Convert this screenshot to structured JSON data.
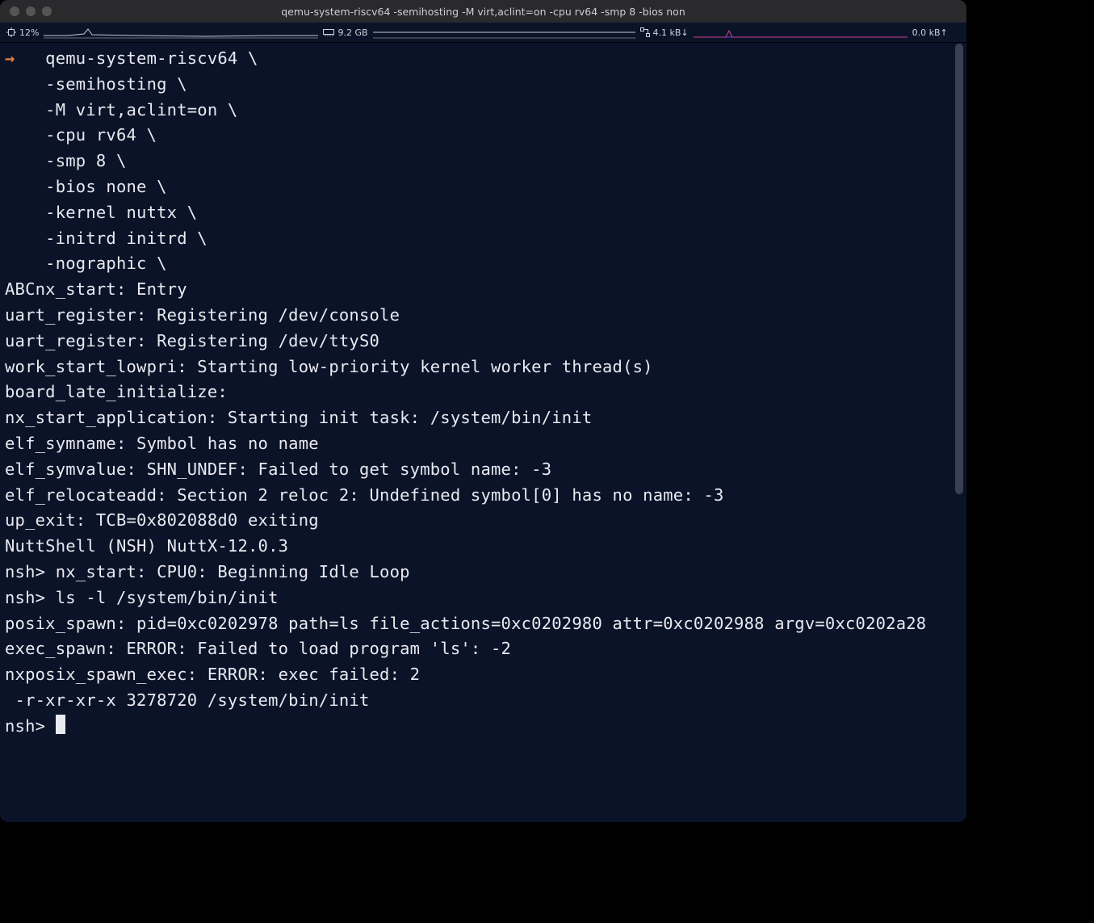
{
  "window": {
    "title": "qemu-system-riscv64 -semihosting -M virt,aclint=on -cpu rv64 -smp 8 -bios non"
  },
  "statsbar": {
    "cpu_label": "12%",
    "ram_label": "9.2 GB",
    "net_down_label": "4.1 kB↓",
    "net_up_label": "0.0 kB↑"
  },
  "terminal": {
    "prompt_arrow": "→",
    "command_lines": [
      "qemu-system-riscv64 \\",
      "-semihosting \\",
      "-M virt,aclint=on \\",
      "-cpu rv64 \\",
      "-smp 8 \\",
      "-bios none \\",
      "-kernel nuttx \\",
      "-initrd initrd \\",
      "-nographic \\"
    ],
    "output_lines": [
      "",
      "ABCnx_start: Entry",
      "uart_register: Registering /dev/console",
      "uart_register: Registering /dev/ttyS0",
      "work_start_lowpri: Starting low-priority kernel worker thread(s)",
      "board_late_initialize:",
      "nx_start_application: Starting init task: /system/bin/init",
      "elf_symname: Symbol has no name",
      "elf_symvalue: SHN_UNDEF: Failed to get symbol name: -3",
      "elf_relocateadd: Section 2 reloc 2: Undefined symbol[0] has no name: -3",
      "up_exit: TCB=0x802088d0 exiting",
      "",
      "NuttShell (NSH) NuttX-12.0.3",
      "nsh> nx_start: CPU0: Beginning Idle Loop",
      "",
      "nsh> ls -l /system/bin/init",
      "posix_spawn: pid=0xc0202978 path=ls file_actions=0xc0202980 attr=0xc0202988 argv=0xc0202a28",
      "exec_spawn: ERROR: Failed to load program 'ls': -2",
      "nxposix_spawn_exec: ERROR: exec failed: 2",
      " -r-xr-xr-x 3278720 /system/bin/init"
    ],
    "final_prompt": "nsh> "
  }
}
